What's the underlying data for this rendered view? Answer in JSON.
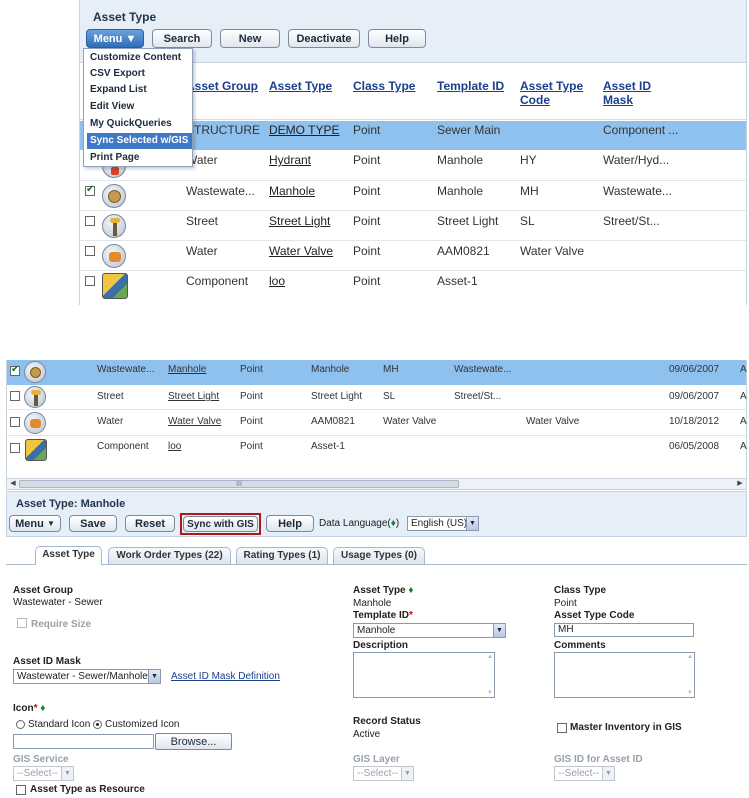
{
  "top_panel": {
    "title": "Asset Type",
    "toolbar": {
      "menu": "Menu",
      "search": "Search",
      "new": "New",
      "deactivate": "Deactivate",
      "help": "Help"
    },
    "menu_items": [
      "Customize Content",
      "CSV Export",
      "Expand List",
      "Edit View",
      "My QuickQueries",
      "Sync Selected w/GIS",
      "Print Page"
    ],
    "columns": [
      "Asset Group",
      "Asset Type",
      "Class Type",
      "Template ID",
      "Asset Type Code",
      "Asset ID Mask"
    ],
    "rows": [
      {
        "group": "STRUCTURE",
        "type": "DEMO TYPE",
        "class": "Point",
        "template": "Sewer Main",
        "code": "",
        "mask": "Component ..."
      },
      {
        "group": "Water",
        "type": "Hydrant",
        "class": "Point",
        "template": "Manhole",
        "code": "HY",
        "mask": "Water/Hyd..."
      },
      {
        "group": "Wastewate...",
        "type": "Manhole",
        "class": "Point",
        "template": "Manhole",
        "code": "MH",
        "mask": "Wastewate..."
      },
      {
        "group": "Street",
        "type": "Street Light",
        "class": "Point",
        "template": "Street Light",
        "code": "SL",
        "mask": "Street/St..."
      },
      {
        "group": "Water",
        "type": "Water Valve",
        "class": "Point",
        "template": "AAM0821",
        "code": "Water Valve",
        "mask": ""
      },
      {
        "group": "Component",
        "type": "loo",
        "class": "Point",
        "template": "Asset-1",
        "code": "",
        "mask": ""
      }
    ]
  },
  "bottom_grid": {
    "rows": [
      {
        "group": "Wastewate...",
        "type": "Manhole",
        "class": "Point",
        "template": "Manhole",
        "code": "MH",
        "mask": "Wastewate...",
        "extra": "",
        "date": "09/06/2007",
        "tail": "A"
      },
      {
        "group": "Street",
        "type": "Street Light",
        "class": "Point",
        "template": "Street Light",
        "code": "SL",
        "mask": "Street/St...",
        "extra": "",
        "date": "09/06/2007",
        "tail": "A"
      },
      {
        "group": "Water",
        "type": "Water Valve",
        "class": "Point",
        "template": "AAM0821",
        "code": "Water Valve",
        "mask": "",
        "extra": "Water Valve",
        "date": "10/18/2012",
        "tail": "A"
      },
      {
        "group": "Component",
        "type": "loo",
        "class": "Point",
        "template": "Asset-1",
        "code": "",
        "mask": "",
        "extra": "",
        "date": "06/05/2008",
        "tail": "A"
      }
    ],
    "scroll_mark": "III"
  },
  "detail": {
    "title": "Asset Type: Manhole",
    "toolbar": {
      "menu": "Menu",
      "save": "Save",
      "reset": "Reset",
      "sync": "Sync with GIS",
      "help": "Help",
      "data_language_label": "Data Language",
      "data_language_value": "English (US)"
    },
    "tabs": [
      "Asset Type",
      "Work Order Types (22)",
      "Rating Types (1)",
      "Usage Types (0)"
    ],
    "fields": {
      "asset_group_label": "Asset Group",
      "asset_group_value": "Wastewater - Sewer",
      "require_size": "Require Size",
      "asset_id_mask_label": "Asset ID Mask",
      "asset_id_mask_value": "Wastewater - Sewer/Manhole",
      "asset_id_mask_link": "Asset ID Mask Definition",
      "icon_label": "Icon",
      "standard_icon": "Standard Icon",
      "customized_icon": "Customized Icon",
      "browse": "Browse...",
      "gis_service_label": "GIS Service",
      "select_placeholder": "--Select--",
      "asset_type_as_resource": "Asset Type as Resource",
      "asset_type_label": "Asset Type",
      "asset_type_value": "Manhole",
      "template_id_label": "Template ID",
      "template_id_value": "Manhole",
      "description_label": "Description",
      "record_status_label": "Record Status",
      "record_status_value": "Active",
      "gis_layer_label": "GIS Layer",
      "class_type_label": "Class Type",
      "class_type_value": "Point",
      "asset_type_code_label": "Asset Type Code",
      "asset_type_code_value": "MH",
      "comments_label": "Comments",
      "master_inventory": "Master Inventory in GIS",
      "gis_id_label": "GIS ID for Asset ID"
    }
  },
  "colors": {
    "header_bg": "#e6eef8",
    "selected_row": "#8fc1ee",
    "accent": "#3f79c6",
    "highlight_border": "#b01818"
  }
}
